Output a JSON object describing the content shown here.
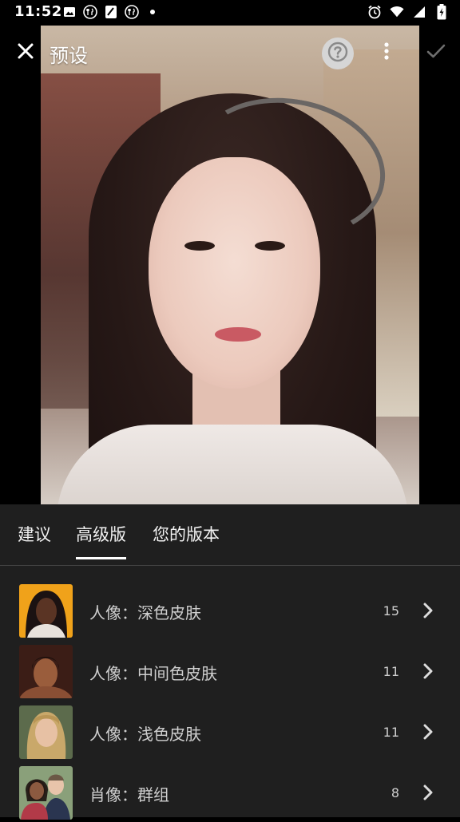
{
  "status_bar": {
    "time": "11:52",
    "left_icons": [
      "image-icon",
      "restaurant-icon",
      "notes-icon",
      "restaurant-icon",
      "dot-icon"
    ],
    "right_icons": [
      "alarm-icon",
      "wifi-icon",
      "signal-icon",
      "battery-charging-icon"
    ]
  },
  "toolbar": {
    "title": "预设",
    "close_icon": "close-icon",
    "help_icon": "help-icon",
    "more_icon": "more-vert-icon",
    "confirm_icon": "check-icon"
  },
  "tabs": [
    {
      "label": "建议",
      "active": false
    },
    {
      "label": "高级版",
      "active": true
    },
    {
      "label": "您的版本",
      "active": false
    }
  ],
  "presets": [
    {
      "label": "人像：深色皮肤",
      "count": "15",
      "thumb": "portrait-dark-skin-thumbnail"
    },
    {
      "label": "人像：中间色皮肤",
      "count": "11",
      "thumb": "portrait-medium-skin-thumbnail"
    },
    {
      "label": "人像：浅色皮肤",
      "count": "11",
      "thumb": "portrait-light-skin-thumbnail"
    },
    {
      "label": "肖像：群组",
      "count": "8",
      "thumb": "portrait-group-thumbnail"
    }
  ],
  "colors": {
    "panel_bg": "#202020",
    "text_primary": "#ffffff",
    "text_secondary": "#cfcfcf",
    "tab_indicator": "#ffffff"
  }
}
